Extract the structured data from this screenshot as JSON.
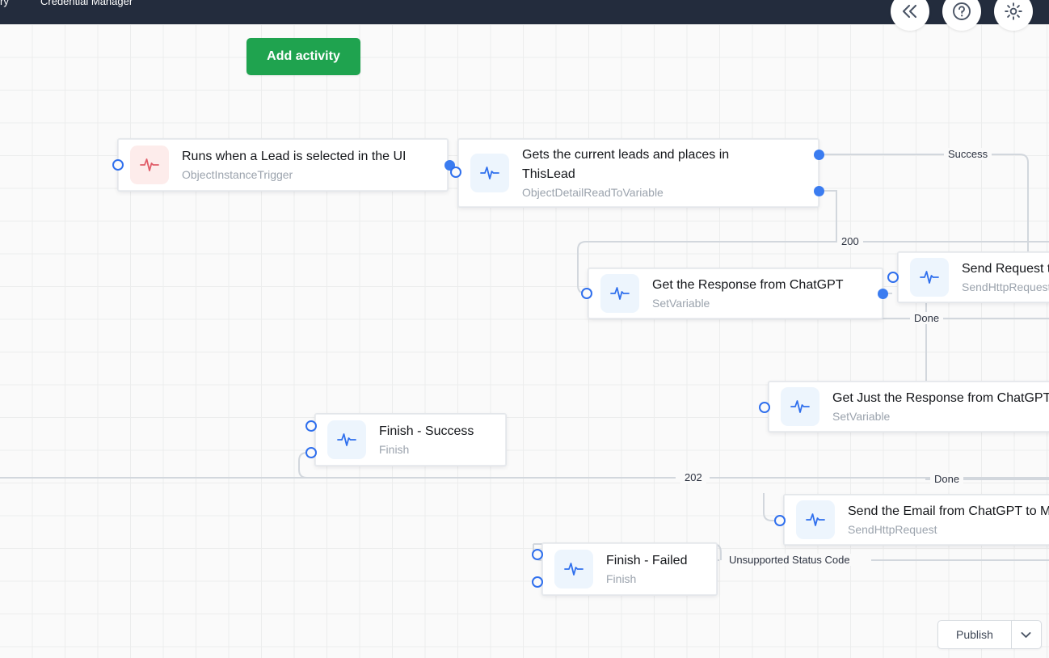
{
  "topbar": {
    "breadcrumb": "ry",
    "title": "Credential Manager",
    "collapse_icon": "double-chevron-left-icon",
    "help_icon": "question-circle-icon",
    "settings_icon": "gear-icon"
  },
  "toolbar": {
    "add_activity_label": "Add activity"
  },
  "footer": {
    "publish_label": "Publish",
    "publish_more_icon": "chevron-down-icon"
  },
  "nodes": [
    {
      "id": "trigger",
      "title": "Runs when a Lead is selected in the UI",
      "subtitle": "ObjectInstanceTrigger",
      "icon": "activity-pulse-icon",
      "icon_variant": "trigger"
    },
    {
      "id": "read-lead",
      "title": "Gets the current leads and places in\nThisLead",
      "subtitle": "ObjectDetailReadToVariable",
      "icon": "activity-pulse-icon",
      "icon_variant": "action"
    },
    {
      "id": "get-response",
      "title": "Get the Response from ChatGPT",
      "subtitle": "SetVariable",
      "icon": "activity-pulse-icon",
      "icon_variant": "action"
    },
    {
      "id": "send-request",
      "title": "Send Request to",
      "subtitle": "SendHttpRequest",
      "icon": "activity-pulse-icon",
      "icon_variant": "action"
    },
    {
      "id": "get-just-response",
      "title": "Get Just the Response from ChatGPT",
      "subtitle": "SetVariable",
      "icon": "activity-pulse-icon",
      "icon_variant": "action"
    },
    {
      "id": "finish-success",
      "title": "Finish - Success",
      "subtitle": "Finish",
      "icon": "activity-pulse-icon",
      "icon_variant": "action"
    },
    {
      "id": "send-email",
      "title": "Send the Email from ChatGPT to M",
      "subtitle": "SendHttpRequest",
      "icon": "activity-pulse-icon",
      "icon_variant": "action"
    },
    {
      "id": "finish-failed",
      "title": "Finish - Failed",
      "subtitle": "Finish",
      "icon": "activity-pulse-icon",
      "icon_variant": "action"
    }
  ],
  "edge_labels": [
    {
      "id": "success",
      "text": "Success"
    },
    {
      "id": "status-200",
      "text": "200"
    },
    {
      "id": "done-1",
      "text": "Done"
    },
    {
      "id": "status-202",
      "text": "202"
    },
    {
      "id": "done-2",
      "text": "Done"
    },
    {
      "id": "unsupported",
      "text": "Unsupported Status Code"
    }
  ],
  "colors": {
    "topbar_bg": "#232c3d",
    "accent_green": "#1fa34f",
    "port_blue": "#2f6fed",
    "edge_gray": "#d2d7dd",
    "canvas_bg": "#fafafa"
  }
}
